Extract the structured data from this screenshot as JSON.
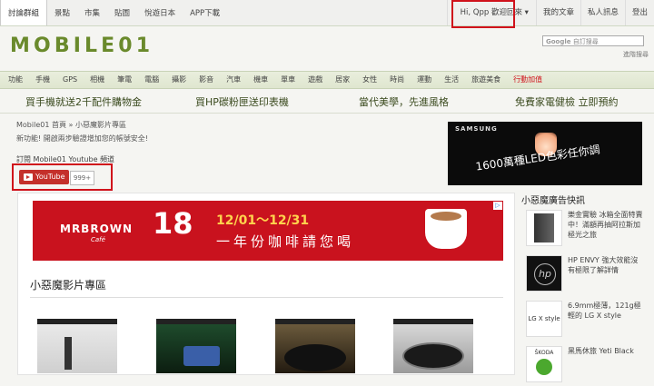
{
  "topbar": {
    "tabs": [
      "討論群組",
      "景點",
      "市集",
      "貼圖",
      "悅遊日本",
      "APP下載"
    ],
    "greeting": "Hi, Qpp 歡迎回來",
    "my_articles": "我的文章",
    "private_msg": "私人訊息",
    "logout": "登出"
  },
  "header": {
    "logo": "MOBILE01",
    "search_brand": "Google",
    "search_placeholder": "自訂搜尋",
    "advanced": "進階搜尋"
  },
  "nav": [
    "功能",
    "手機",
    "GPS",
    "相機",
    "筆電",
    "電腦",
    "攝影",
    "影音",
    "汽車",
    "機車",
    "單車",
    "遊戲",
    "居家",
    "女性",
    "時尚",
    "運動",
    "生活",
    "旅遊美食",
    "行動加值"
  ],
  "promos": [
    "買手機就送2千配件購物金",
    "買HP碳粉匣送印表機",
    "當代美學，先進風格",
    "免費家電健檢 立即預約"
  ],
  "breadcrumb": "Mobile01 首頁 » 小惡魔影片專區",
  "new_feature": "新功能! 開啟兩步驗證增加您的帳號安全!",
  "subscribe_label": "訂閱 Mobile01 Youtube 頻道",
  "youtube": {
    "label": "YouTube",
    "count": "999+"
  },
  "samsung_ad": {
    "brand": "SAMSUNG",
    "text": "1600萬種LED色彩任你調"
  },
  "banner": {
    "brand": "MRBROWN",
    "sub": "Café",
    "big": "18",
    "date": "12/01～12/31",
    "slogan": "一年份咖啡請您喝"
  },
  "section_title": "小惡魔影片專區",
  "sidebar": {
    "title": "小惡魔廣告快訊",
    "items": [
      {
        "text": "樂金實驗 冰箱全面特賣中！滿額再抽阿拉斯加極光之旅"
      },
      {
        "text": "HP ENVY 強大效能沒有極限了解詳情"
      },
      {
        "text": "6.9mm極薄，121g極輕的 LG X style",
        "logo": "LG X style"
      },
      {
        "text": "黑馬休旅 Yeti Black",
        "logo": "ŠKODA"
      }
    ]
  },
  "colors": {
    "accent": "#d0121b",
    "logo_green": "#6a8a2c",
    "nav_bg": "#e3e9d4"
  }
}
